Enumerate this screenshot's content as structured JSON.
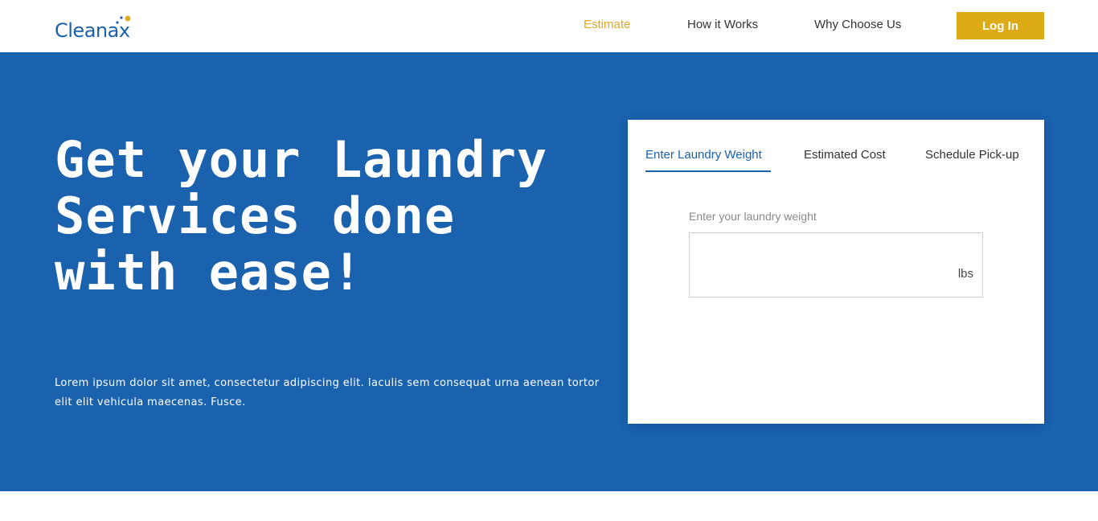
{
  "header": {
    "logo_text": "leanax",
    "logo_initial": "C",
    "nav": {
      "estimate": "Estimate",
      "how_it_works": "How it Works",
      "why_choose_us": "Why Choose Us"
    },
    "login_label": "Log In"
  },
  "hero": {
    "headline": "Get your Laundry Services done with ease!",
    "subtext": "Lorem ipsum dolor sit amet, consectetur adipiscing elit. Iaculis sem consequat urna aenean tortor elit elit vehicula maecenas. Fusce."
  },
  "estimate_card": {
    "tabs": {
      "weight": "Enter Laundry Weight",
      "cost": "Estimated Cost",
      "pickup": "Schedule Pick-up"
    },
    "field_label": "Enter your laundry weight",
    "field_value": "",
    "field_unit": "lbs"
  },
  "colors": {
    "brand_blue": "#1a61ae",
    "accent_gold": "#ddab15"
  }
}
